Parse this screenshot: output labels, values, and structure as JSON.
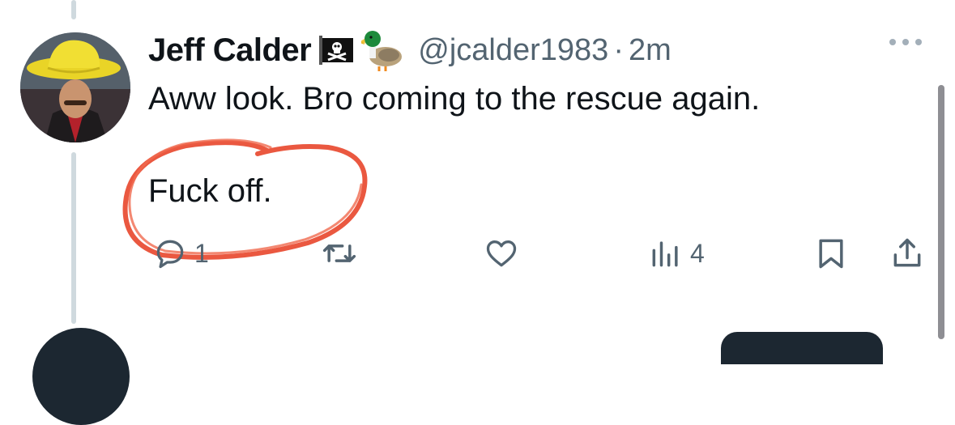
{
  "tweet": {
    "display_name": "Jeff Calder",
    "name_emojis": [
      "pirate-flag",
      "duck"
    ],
    "handle": "@jcalder1983",
    "separator": "·",
    "time": "2m",
    "text_lines": [
      "Aww look. Bro coming to the rescue again.",
      "Fuck off."
    ],
    "actions": {
      "reply_count": "1",
      "retweet_count": "",
      "like_count": "",
      "views_count": "4"
    }
  },
  "colors": {
    "text": "#0f1419",
    "secondary": "#536471",
    "thread_line": "#cfd9de",
    "annotation": "#e8462b"
  }
}
